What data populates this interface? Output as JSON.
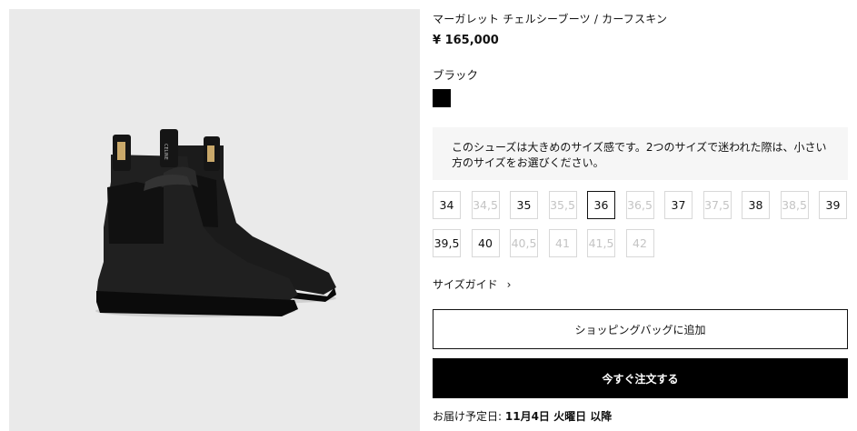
{
  "product": {
    "title": "マーガレット チェルシーブーツ / カーフスキン",
    "price": "¥ 165,000",
    "color_name": "ブラック",
    "swatch_color": "#000000",
    "image_icon": "chelsea-boots-image",
    "label_text": "CELINE"
  },
  "notice": "このシューズは大きめのサイズ感です。2つのサイズで迷われた際は、小さい方のサイズをお選びください。",
  "sizes": [
    {
      "label": "34",
      "available": true,
      "selected": false
    },
    {
      "label": "34,5",
      "available": false,
      "selected": false
    },
    {
      "label": "35",
      "available": true,
      "selected": false
    },
    {
      "label": "35,5",
      "available": false,
      "selected": false
    },
    {
      "label": "36",
      "available": true,
      "selected": true
    },
    {
      "label": "36,5",
      "available": false,
      "selected": false
    },
    {
      "label": "37",
      "available": true,
      "selected": false
    },
    {
      "label": "37,5",
      "available": false,
      "selected": false
    },
    {
      "label": "38",
      "available": true,
      "selected": false
    },
    {
      "label": "38,5",
      "available": false,
      "selected": false
    },
    {
      "label": "39",
      "available": true,
      "selected": false
    },
    {
      "label": "39,5",
      "available": true,
      "selected": false
    },
    {
      "label": "40",
      "available": true,
      "selected": false
    },
    {
      "label": "40,5",
      "available": false,
      "selected": false
    },
    {
      "label": "41",
      "available": false,
      "selected": false
    },
    {
      "label": "41,5",
      "available": false,
      "selected": false
    },
    {
      "label": "42",
      "available": false,
      "selected": false
    }
  ],
  "size_guide": {
    "label": "サイズガイド",
    "icon": "chevron-right-icon"
  },
  "buttons": {
    "add_to_bag": "ショッピングバッグに追加",
    "buy_now": "今すぐ注文する"
  },
  "delivery": {
    "prefix": "お届け予定日:",
    "date": "11月4日 火曜日 以降"
  }
}
